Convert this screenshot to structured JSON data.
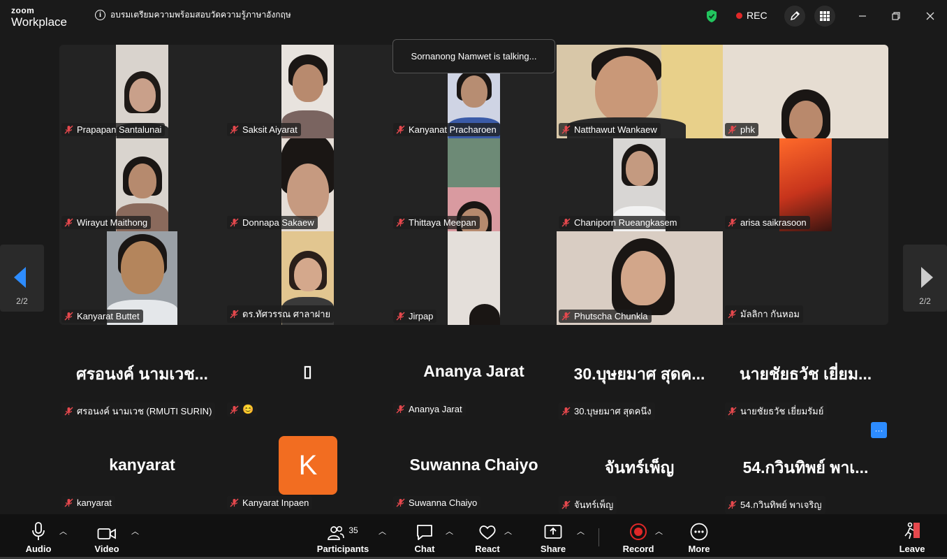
{
  "app": {
    "logo_top": "zoom",
    "logo_bottom": "Workplace"
  },
  "meeting": {
    "title": "อบรมเตรียมความพร้อมสอบวัดความรู้ภาษาอังกฤษ",
    "rec_label": "REC"
  },
  "toast": "Sornanong Namwet is talking...",
  "pagination": {
    "left": "2/2",
    "right": "2/2"
  },
  "video_tiles": [
    "Prapapan Santalunai",
    "Saksit Aiyarat",
    "Kanyanat Pracharoen",
    "Natthawut Wankaew",
    "phk",
    "Wirayut Maithong",
    "Donnapa Sakaew",
    "Thittaya Meepan",
    "Chaniporn Rueangkasem",
    "arisa saikrasoon",
    "Kanyarat Buttet",
    "ดร.ทัศวรรณ ศาลาฝาย",
    "Jirpap",
    "Phutscha Chunkla",
    "มัลลิกา กันหอม"
  ],
  "name_tiles": [
    {
      "big": "ศรอนงค์ นามเวช...",
      "tag": "ศรอนงค์ นามเวช (RMUTI SURIN)"
    },
    {
      "big": "▯",
      "tag": "😊"
    },
    {
      "big": "Ananya Jarat",
      "tag": "Ananya Jarat"
    },
    {
      "big": "30.บุษยมาศ สุดค...",
      "tag": "30.บุษยมาศ สุดคนึง"
    },
    {
      "big": "นายชัยธวัช เยี่ยม...",
      "tag": "นายชัยธวัช เยี่ยมรัมย์"
    },
    {
      "big": "kanyarat",
      "tag": "kanyarat"
    },
    {
      "big": "",
      "tag": "Kanyarat Inpaen",
      "avatar": "K"
    },
    {
      "big": "Suwanna Chaiyo",
      "tag": "Suwanna Chaiyo"
    },
    {
      "big": "จันทร์เพ็ญ",
      "tag": "จันทร์เพ็ญ"
    },
    {
      "big": "54.กวินทิพย์ พาเ...",
      "tag": "54.กวินทิพย์ พาเจริญ"
    }
  ],
  "more_options_badge": "···",
  "toolbar": {
    "audio": "Audio",
    "video": "Video",
    "participants": "Participants",
    "participant_count": "35",
    "chat": "Chat",
    "react": "React",
    "share": "Share",
    "record": "Record",
    "more": "More",
    "leave": "Leave"
  },
  "colors": {
    "avatar_orange": "#f26d21",
    "nav_arrow_blue": "#2d8cff",
    "record_red": "#e02828",
    "shield_green": "#22c55e",
    "mic_off_red": "#e5484d"
  }
}
